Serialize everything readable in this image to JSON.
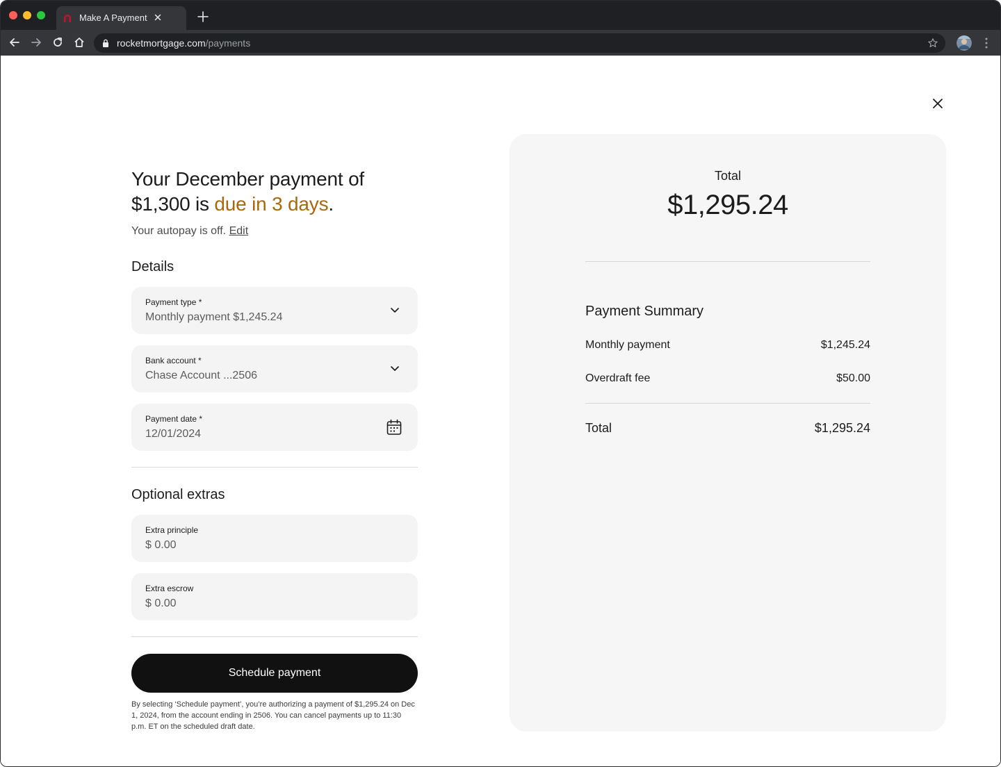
{
  "browser": {
    "tab_title": "Make A Payment",
    "url_domain": "rocketmortgage.com",
    "url_path": "/payments"
  },
  "page": {
    "heading_prefix": "Your December payment of $1,300 is ",
    "heading_due": "due in 3 days",
    "heading_suffix": ".",
    "autopay_text": "Your autopay is off.",
    "autopay_edit": "Edit",
    "details_title": "Details",
    "fields": [
      {
        "label": "Payment type *",
        "value": "Monthly payment $1,245.24",
        "icon": "chevron-down-icon"
      },
      {
        "label": "Bank account *",
        "value": "Chase Account ...2506",
        "icon": "chevron-down-icon"
      },
      {
        "label": "Payment date *",
        "value": "12/01/2024",
        "icon": "calendar-icon"
      }
    ],
    "extras_title": "Optional extras",
    "extras": [
      {
        "label": "Extra principle",
        "value": "$ 0.00"
      },
      {
        "label": "Extra escrow",
        "value": "$ 0.00"
      }
    ],
    "schedule_button": "Schedule payment",
    "disclaimer": "By selecting ‘Schedule payment’, you’re authorizing a payment of $1,295.24 on Dec 1, 2024, from the account ending in 2506. You can cancel payments up to 11:30 p.m. ET on the scheduled draft date."
  },
  "summary": {
    "total_label": "Total",
    "total_value": "$1,295.24",
    "title": "Payment Summary",
    "rows": [
      {
        "label": "Monthly payment",
        "value": "$1,245.24"
      },
      {
        "label": "Overdraft fee",
        "value": "$50.00"
      }
    ],
    "total_row": {
      "label": "Total",
      "value": "$1,295.24"
    }
  },
  "colors": {
    "due_accent": "#a8680e",
    "button_bg": "#111111",
    "panel_bg": "#f6f6f6",
    "field_bg": "#f4f4f4"
  }
}
